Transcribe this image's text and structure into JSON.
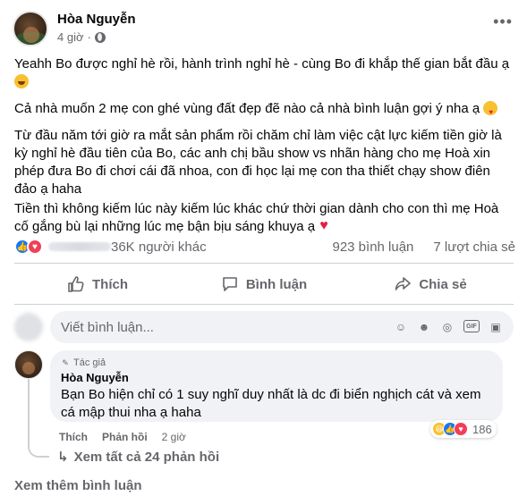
{
  "post": {
    "author": "Hòa Nguyễn",
    "time": "4 giờ",
    "separator": "·",
    "more_label": "•••",
    "paragraphs": [
      "Yeahh Bo được nghỉ hè rồi, hành trình nghỉ hè - cùng Bo đi khắp thế gian bắt đầu ạ",
      "Cả nhà muốn 2 mẹ con ghé vùng đất đẹp đẽ nào cả nhà bình luận gợi ý nha ạ",
      "Từ đầu năm tới giờ ra mắt sản phẩm rồi chăm chỉ làm việc cật lực kiếm tiền giờ là kỳ nghỉ hè đầu tiên của Bo, các anh chị bầu show vs nhãn hàng cho mẹ Hoà xin phép đưa Bo đi chơi cái đã nhoa, con đi học lại mẹ con tha thiết chạy show điên đảo ạ haha",
      "Tiền thì không kiếm lúc này kiếm lúc khác chứ thời gian dành cho con thì mẹ Hoà cố gắng bù lại những lúc mẹ bận bịu sáng khuya ạ"
    ],
    "emojis": [
      "laughing-emoji",
      "smiling-face-with-hearts-emoji",
      "red-heart-emoji"
    ]
  },
  "stats": {
    "reactions_text": "36K người khác",
    "comments": "923 bình luận",
    "shares": "7 lượt chia sẻ"
  },
  "actions": {
    "like": "Thích",
    "comment": "Bình luận",
    "share": "Chia sẻ"
  },
  "comment_input": {
    "placeholder": "Viết bình luận..."
  },
  "top_comment": {
    "badge": "Tác giả",
    "author": "Hòa Nguyễn",
    "text": "Bạn Bo hiện chỉ có 1 suy nghĩ duy nhất là dc đi biển nghịch cát và xem cá mập thui nha ạ haha",
    "like": "Thích",
    "reply": "Phản hồi",
    "time": "2 giờ",
    "reaction_count": "186",
    "see_replies": "Xem tất cả 24 phản hồi"
  },
  "see_more_comments": "Xem thêm bình luận",
  "colors": {
    "like_blue": "#1877f2",
    "love_red": "#f33e58",
    "secondary_text": "#65676b",
    "comment_bg": "#f0f2f5"
  }
}
